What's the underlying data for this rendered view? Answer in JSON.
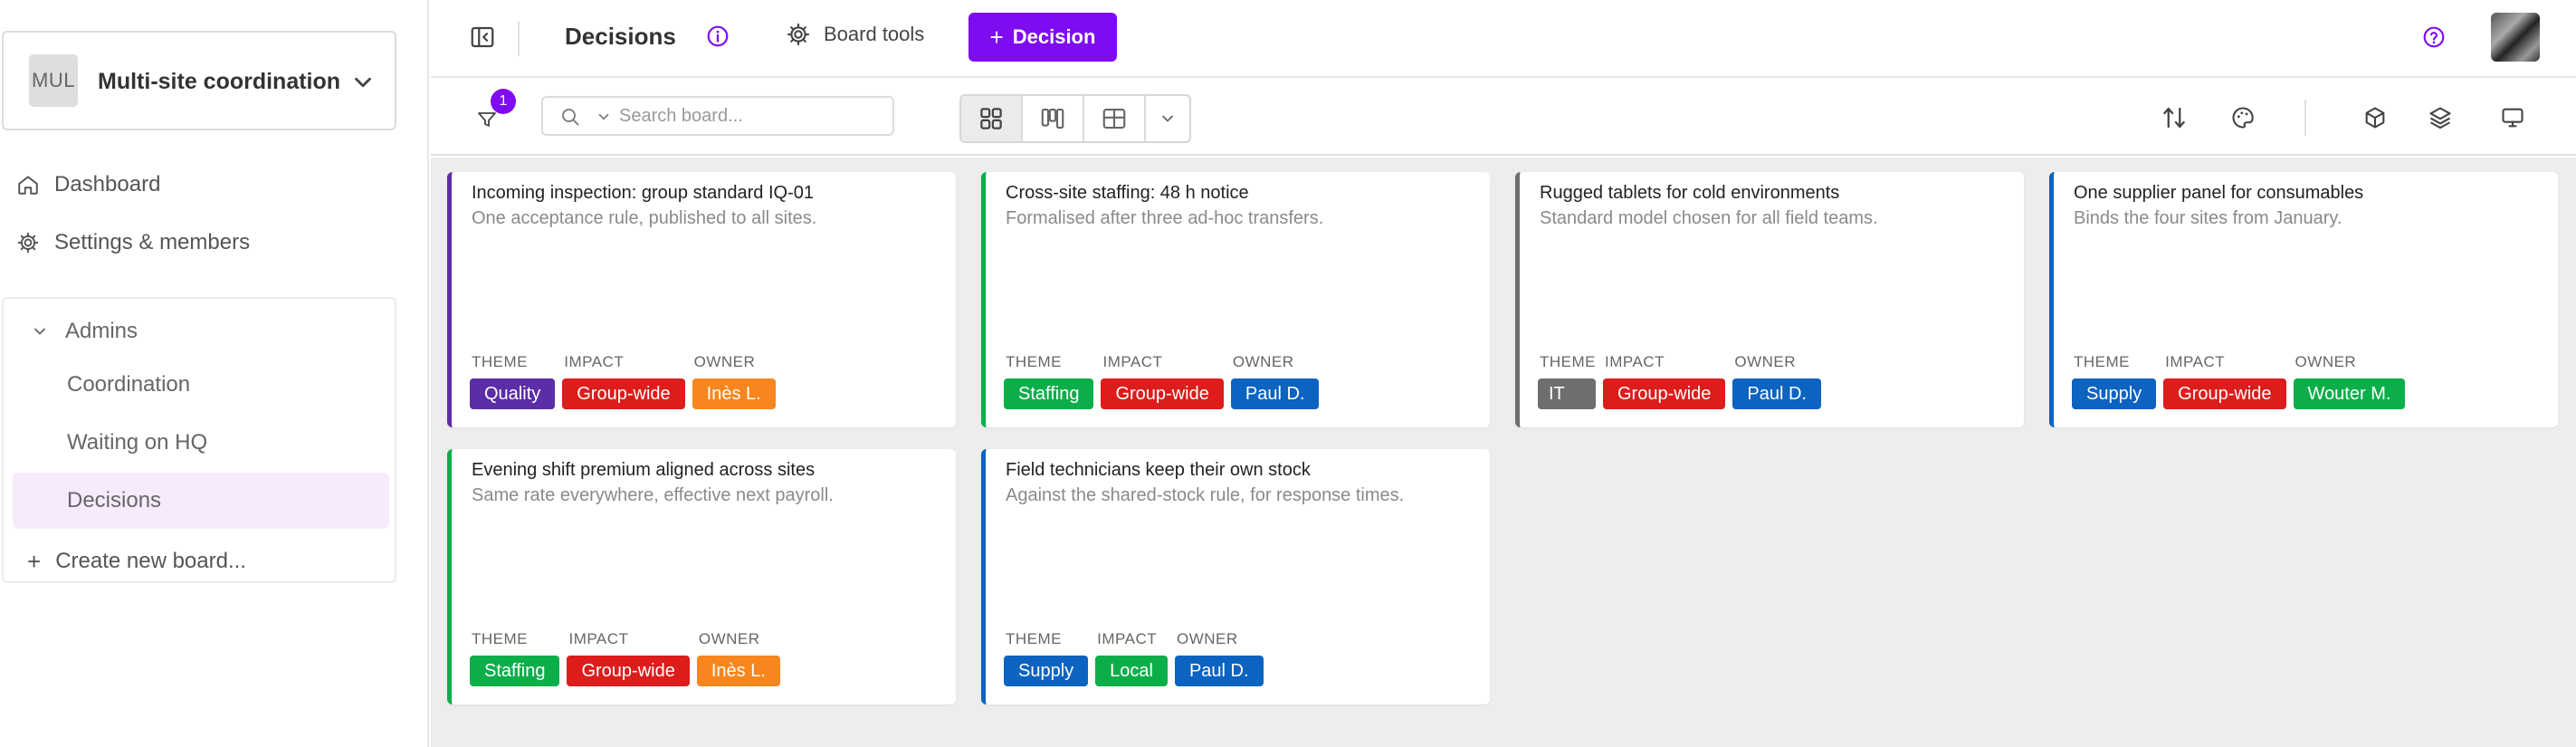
{
  "workspace": {
    "abbr": "MUL",
    "name": "Multi-site coordination"
  },
  "sidebar": {
    "dashboard": "Dashboard",
    "settings": "Settings & members",
    "section": "Admins",
    "boards": [
      {
        "label": "Coordination",
        "active": false
      },
      {
        "label": "Waiting on HQ",
        "active": false
      },
      {
        "label": "Decisions",
        "active": true
      }
    ],
    "create": "Create new board..."
  },
  "header": {
    "title": "Decisions",
    "board_tools": "Board tools",
    "primary_button": "Decision"
  },
  "toolbar": {
    "filter_count": "1",
    "search_placeholder": "Search board..."
  },
  "colors": {
    "accent": "#7f0cf0",
    "purple": "#5b2da6",
    "red": "#dd1c1c",
    "orange": "#f7861e",
    "green": "#0cae4a",
    "blue": "#0c63c0",
    "gray": "#6e6e6e"
  },
  "field_labels": {
    "theme": "THEME",
    "impact": "IMPACT",
    "owner": "OWNER"
  },
  "cards": [
    {
      "title": "Incoming inspection: group standard IQ-01",
      "subtitle": "One acceptance rule, published to all sites.",
      "stripe": "#5b2da6",
      "theme": {
        "label": "Quality",
        "color": "#5b2da6"
      },
      "impact": {
        "label": "Group-wide",
        "color": "#dd1c1c"
      },
      "owner": {
        "label": "Inès L.",
        "color": "#f7861e"
      }
    },
    {
      "title": "Cross-site staffing: 48 h notice",
      "subtitle": "Formalised after three ad-hoc transfers.",
      "stripe": "#0cae4a",
      "theme": {
        "label": "Staffing",
        "color": "#0cae4a"
      },
      "impact": {
        "label": "Group-wide",
        "color": "#dd1c1c"
      },
      "owner": {
        "label": "Paul D.",
        "color": "#0c63c0"
      }
    },
    {
      "title": "Rugged tablets for cold environments",
      "subtitle": "Standard model chosen for all field teams.",
      "stripe": "#6e6e6e",
      "theme": {
        "label": "IT",
        "color": "#6e6e6e"
      },
      "impact": {
        "label": "Group-wide",
        "color": "#dd1c1c"
      },
      "owner": {
        "label": "Paul D.",
        "color": "#0c63c0"
      }
    },
    {
      "title": "One supplier panel for consumables",
      "subtitle": "Binds the four sites from January.",
      "stripe": "#0c63c0",
      "theme": {
        "label": "Supply",
        "color": "#0c63c0"
      },
      "impact": {
        "label": "Group-wide",
        "color": "#dd1c1c"
      },
      "owner": {
        "label": "Wouter M.",
        "color": "#0cae4a"
      }
    },
    {
      "title": "Evening shift premium aligned across sites",
      "subtitle": "Same rate everywhere, effective next payroll.",
      "stripe": "#0cae4a",
      "theme": {
        "label": "Staffing",
        "color": "#0cae4a"
      },
      "impact": {
        "label": "Group-wide",
        "color": "#dd1c1c"
      },
      "owner": {
        "label": "Inès L.",
        "color": "#f7861e"
      }
    },
    {
      "title": "Field technicians keep their own stock",
      "subtitle": "Against the shared-stock rule, for response times.",
      "stripe": "#0c63c0",
      "theme": {
        "label": "Supply",
        "color": "#0c63c0"
      },
      "impact": {
        "label": "Local",
        "color": "#0cae4a"
      },
      "owner": {
        "label": "Paul D.",
        "color": "#0c63c0"
      }
    }
  ]
}
